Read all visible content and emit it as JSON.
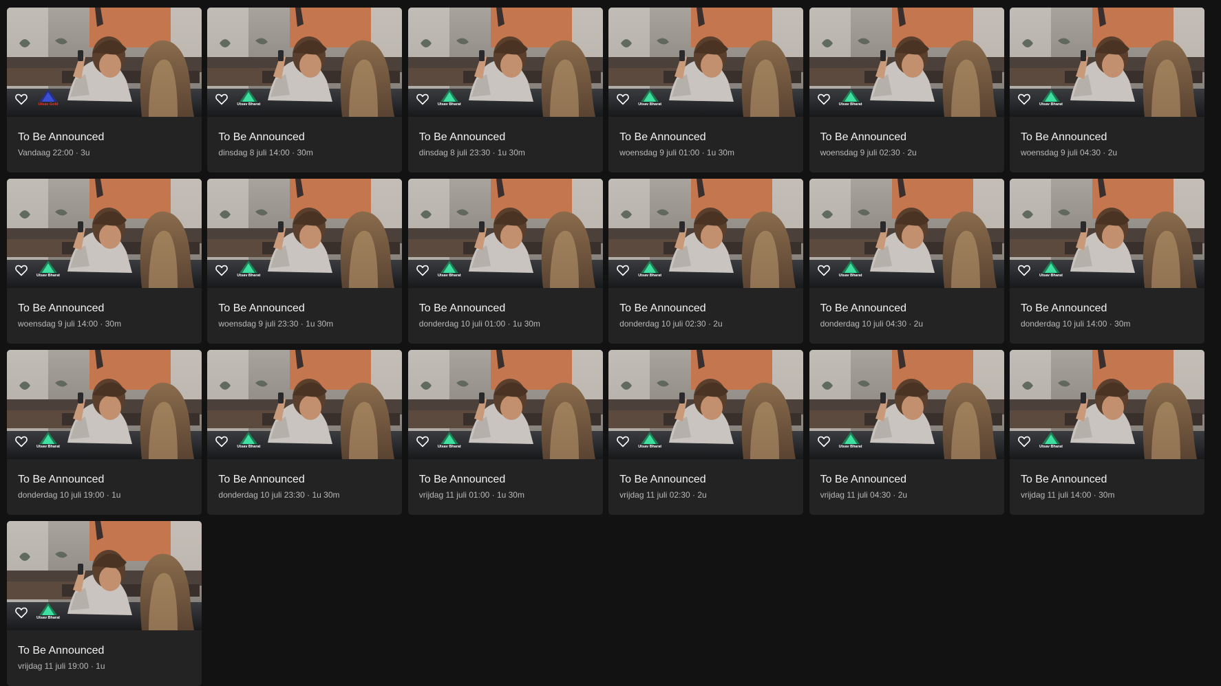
{
  "colors": {
    "page_background": "#121213",
    "card_background": "#232324",
    "title_text": "#f2f2f2",
    "meta_text": "#b9b9b9",
    "logo_bharat_green": "#27c97a",
    "logo_gold_blue": "#3a4fd6"
  },
  "programs": [
    {
      "title": "To Be Announced",
      "meta": "Vandaag 22:00 · 3u",
      "channel_logo": "Utsav Gold",
      "logo_style": "gold",
      "favorite_icon": "heart-outline-icon"
    },
    {
      "title": "To Be Announced",
      "meta": "dinsdag 8 juli 14:00 · 30m",
      "channel_logo": "Utsav Bharat",
      "logo_style": "bharat",
      "favorite_icon": "heart-outline-icon"
    },
    {
      "title": "To Be Announced",
      "meta": "dinsdag 8 juli 23:30 · 1u 30m",
      "channel_logo": "Utsav Bharat",
      "logo_style": "bharat",
      "favorite_icon": "heart-outline-icon"
    },
    {
      "title": "To Be Announced",
      "meta": "woensdag 9 juli 01:00 · 1u 30m",
      "channel_logo": "Utsav Bharat",
      "logo_style": "bharat",
      "favorite_icon": "heart-outline-icon"
    },
    {
      "title": "To Be Announced",
      "meta": "woensdag 9 juli 02:30 · 2u",
      "channel_logo": "Utsav Bharat",
      "logo_style": "bharat",
      "favorite_icon": "heart-outline-icon"
    },
    {
      "title": "To Be Announced",
      "meta": "woensdag 9 juli 04:30 · 2u",
      "channel_logo": "Utsav Bharat",
      "logo_style": "bharat",
      "favorite_icon": "heart-outline-icon"
    },
    {
      "title": "To Be Announced",
      "meta": "woensdag 9 juli 14:00 · 30m",
      "channel_logo": "Utsav Bharat",
      "logo_style": "bharat",
      "favorite_icon": "heart-outline-icon"
    },
    {
      "title": "To Be Announced",
      "meta": "woensdag 9 juli 23:30 · 1u 30m",
      "channel_logo": "Utsav Bharat",
      "logo_style": "bharat",
      "favorite_icon": "heart-outline-icon"
    },
    {
      "title": "To Be Announced",
      "meta": "donderdag 10 juli 01:00 · 1u 30m",
      "channel_logo": "Utsav Bharat",
      "logo_style": "bharat",
      "favorite_icon": "heart-outline-icon"
    },
    {
      "title": "To Be Announced",
      "meta": "donderdag 10 juli 02:30 · 2u",
      "channel_logo": "Utsav Bharat",
      "logo_style": "bharat",
      "favorite_icon": "heart-outline-icon"
    },
    {
      "title": "To Be Announced",
      "meta": "donderdag 10 juli 04:30 · 2u",
      "channel_logo": "Utsav Bharat",
      "logo_style": "bharat",
      "favorite_icon": "heart-outline-icon"
    },
    {
      "title": "To Be Announced",
      "meta": "donderdag 10 juli 14:00 · 30m",
      "channel_logo": "Utsav Bharat",
      "logo_style": "bharat",
      "favorite_icon": "heart-outline-icon"
    },
    {
      "title": "To Be Announced",
      "meta": "donderdag 10 juli 19:00 · 1u",
      "channel_logo": "Utsav Bharat",
      "logo_style": "bharat",
      "favorite_icon": "heart-outline-icon"
    },
    {
      "title": "To Be Announced",
      "meta": "donderdag 10 juli 23:30 · 1u 30m",
      "channel_logo": "Utsav Bharat",
      "logo_style": "bharat",
      "favorite_icon": "heart-outline-icon"
    },
    {
      "title": "To Be Announced",
      "meta": "vrijdag 11 juli 01:00 · 1u 30m",
      "channel_logo": "Utsav Bharat",
      "logo_style": "bharat",
      "favorite_icon": "heart-outline-icon"
    },
    {
      "title": "To Be Announced",
      "meta": "vrijdag 11 juli 02:30 · 2u",
      "channel_logo": "Utsav Bharat",
      "logo_style": "bharat",
      "favorite_icon": "heart-outline-icon"
    },
    {
      "title": "To Be Announced",
      "meta": "vrijdag 11 juli 04:30 · 2u",
      "channel_logo": "Utsav Bharat",
      "logo_style": "bharat",
      "favorite_icon": "heart-outline-icon"
    },
    {
      "title": "To Be Announced",
      "meta": "vrijdag 11 juli 14:00 · 30m",
      "channel_logo": "Utsav Bharat",
      "logo_style": "bharat",
      "favorite_icon": "heart-outline-icon"
    },
    {
      "title": "To Be Announced",
      "meta": "vrijdag 11 juli 19:00 · 1u",
      "channel_logo": "Utsav Bharat",
      "logo_style": "bharat",
      "favorite_icon": "heart-outline-icon"
    }
  ]
}
